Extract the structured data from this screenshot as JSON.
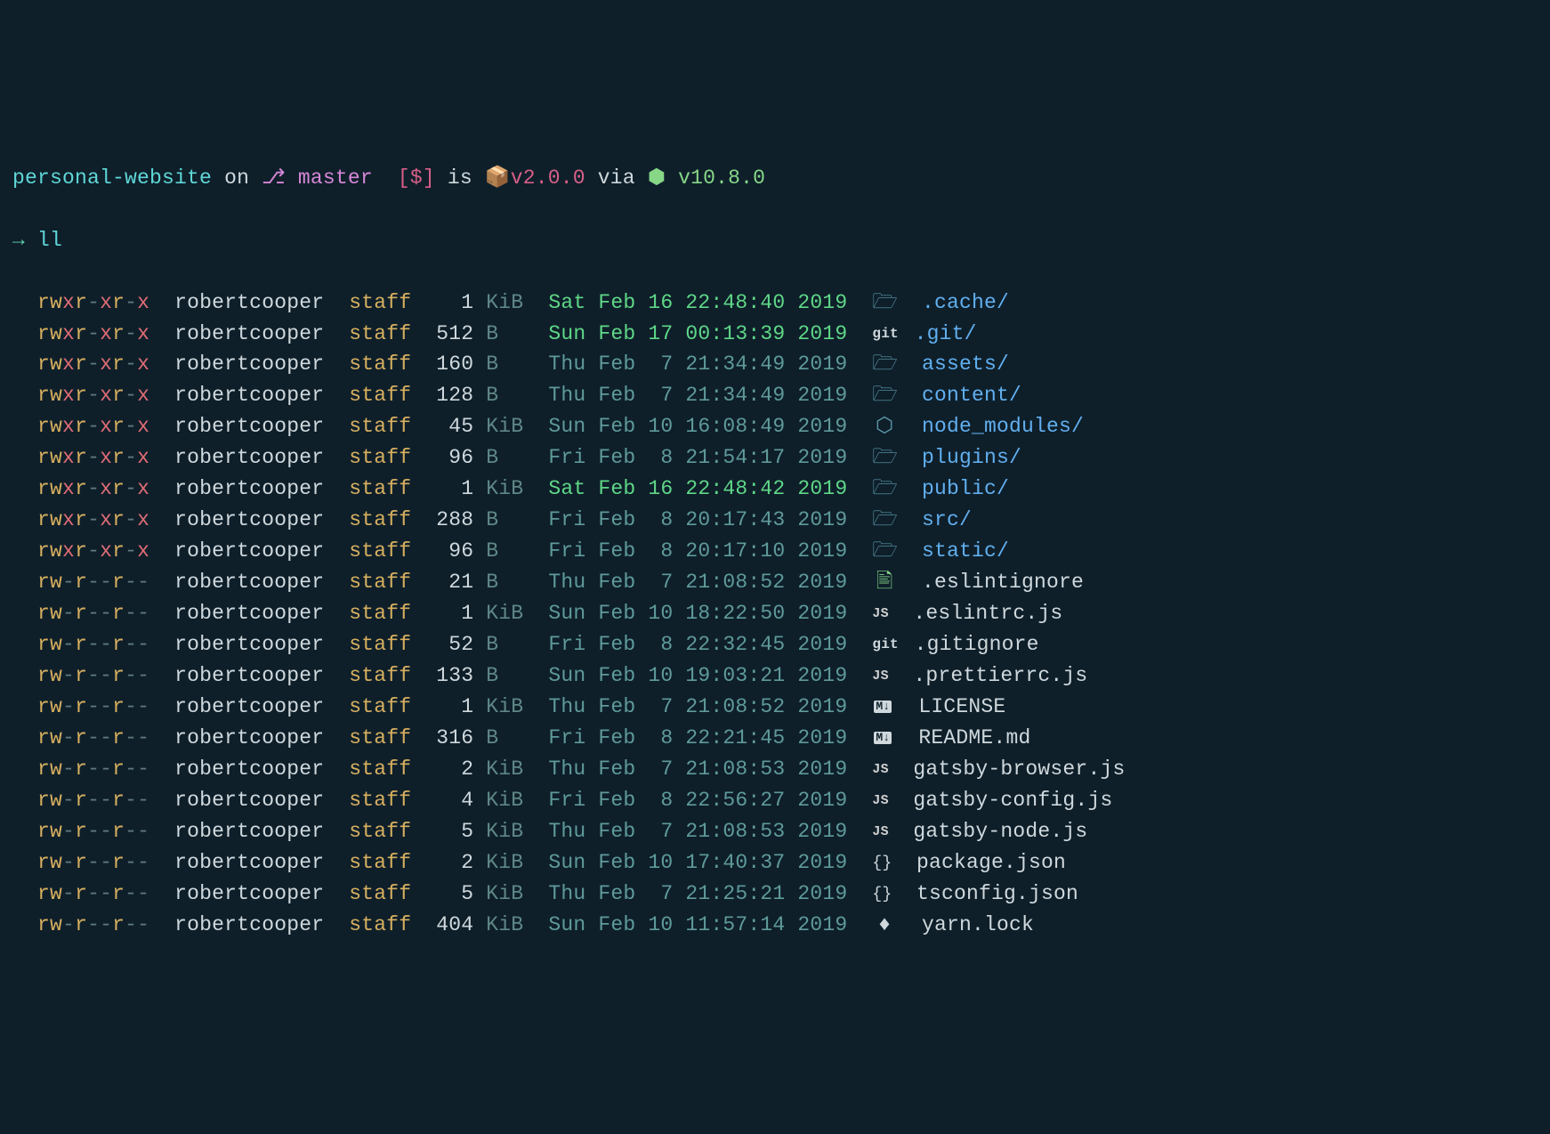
{
  "prompt": {
    "dir": "personal-website",
    "on": "on",
    "branch_icon": "⎇",
    "branch": "master",
    "status": "[$]",
    "is": "is",
    "pkg_icon": "📦",
    "version": "v2.0.0",
    "via": "via",
    "node_icon": "⬢",
    "node_version": "v10.8.0",
    "arrow": "→",
    "command": "ll"
  },
  "rows": [
    {
      "perm": "rwxr-xr-x",
      "owner": "robertcooper",
      "group": "staff",
      "size_n": "1",
      "size_u": "KiB",
      "date": "Sat Feb 16 22:48:40 2019",
      "bright": true,
      "icon": "folder",
      "name": ".cache/",
      "dir": true
    },
    {
      "perm": "rwxr-xr-x",
      "owner": "robertcooper",
      "group": "staff",
      "size_n": "512",
      "size_u": "B",
      "date": "Sun Feb 17 00:13:39 2019",
      "bright": true,
      "icon": "git",
      "name": ".git/",
      "dir": true
    },
    {
      "perm": "rwxr-xr-x",
      "owner": "robertcooper",
      "group": "staff",
      "size_n": "160",
      "size_u": "B",
      "date": "Thu Feb  7 21:34:49 2019",
      "bright": false,
      "icon": "folder",
      "name": "assets/",
      "dir": true
    },
    {
      "perm": "rwxr-xr-x",
      "owner": "robertcooper",
      "group": "staff",
      "size_n": "128",
      "size_u": "B",
      "date": "Thu Feb  7 21:34:49 2019",
      "bright": false,
      "icon": "folder",
      "name": "content/",
      "dir": true
    },
    {
      "perm": "rwxr-xr-x",
      "owner": "robertcooper",
      "group": "staff",
      "size_n": "45",
      "size_u": "KiB",
      "date": "Sun Feb 10 16:08:49 2019",
      "bright": false,
      "icon": "node",
      "name": "node_modules/",
      "dir": true
    },
    {
      "perm": "rwxr-xr-x",
      "owner": "robertcooper",
      "group": "staff",
      "size_n": "96",
      "size_u": "B",
      "date": "Fri Feb  8 21:54:17 2019",
      "bright": false,
      "icon": "folder",
      "name": "plugins/",
      "dir": true
    },
    {
      "perm": "rwxr-xr-x",
      "owner": "robertcooper",
      "group": "staff",
      "size_n": "1",
      "size_u": "KiB",
      "date": "Sat Feb 16 22:48:42 2019",
      "bright": true,
      "icon": "folder",
      "name": "public/",
      "dir": true
    },
    {
      "perm": "rwxr-xr-x",
      "owner": "robertcooper",
      "group": "staff",
      "size_n": "288",
      "size_u": "B",
      "date": "Fri Feb  8 20:17:43 2019",
      "bright": false,
      "icon": "folder",
      "name": "src/",
      "dir": true
    },
    {
      "perm": "rwxr-xr-x",
      "owner": "robertcooper",
      "group": "staff",
      "size_n": "96",
      "size_u": "B",
      "date": "Fri Feb  8 20:17:10 2019",
      "bright": false,
      "icon": "folder",
      "name": "static/",
      "dir": true
    },
    {
      "perm": "rw-r--r--",
      "owner": "robertcooper",
      "group": "staff",
      "size_n": "21",
      "size_u": "B",
      "date": "Thu Feb  7 21:08:52 2019",
      "bright": false,
      "icon": "file-green",
      "name": ".eslintignore",
      "dir": false
    },
    {
      "perm": "rw-r--r--",
      "owner": "robertcooper",
      "group": "staff",
      "size_n": "1",
      "size_u": "KiB",
      "date": "Sun Feb 10 18:22:50 2019",
      "bright": false,
      "icon": "js",
      "name": ".eslintrc.js",
      "dir": false
    },
    {
      "perm": "rw-r--r--",
      "owner": "robertcooper",
      "group": "staff",
      "size_n": "52",
      "size_u": "B",
      "date": "Fri Feb  8 22:32:45 2019",
      "bright": false,
      "icon": "git",
      "name": ".gitignore",
      "dir": false
    },
    {
      "perm": "rw-r--r--",
      "owner": "robertcooper",
      "group": "staff",
      "size_n": "133",
      "size_u": "B",
      "date": "Sun Feb 10 19:03:21 2019",
      "bright": false,
      "icon": "js",
      "name": ".prettierrc.js",
      "dir": false
    },
    {
      "perm": "rw-r--r--",
      "owner": "robertcooper",
      "group": "staff",
      "size_n": "1",
      "size_u": "KiB",
      "date": "Thu Feb  7 21:08:52 2019",
      "bright": false,
      "icon": "md",
      "name": "LICENSE",
      "dir": false
    },
    {
      "perm": "rw-r--r--",
      "owner": "robertcooper",
      "group": "staff",
      "size_n": "316",
      "size_u": "B",
      "date": "Fri Feb  8 22:21:45 2019",
      "bright": false,
      "icon": "md",
      "name": "README.md",
      "dir": false
    },
    {
      "perm": "rw-r--r--",
      "owner": "robertcooper",
      "group": "staff",
      "size_n": "2",
      "size_u": "KiB",
      "date": "Thu Feb  7 21:08:53 2019",
      "bright": false,
      "icon": "js",
      "name": "gatsby-browser.js",
      "dir": false
    },
    {
      "perm": "rw-r--r--",
      "owner": "robertcooper",
      "group": "staff",
      "size_n": "4",
      "size_u": "KiB",
      "date": "Fri Feb  8 22:56:27 2019",
      "bright": false,
      "icon": "js",
      "name": "gatsby-config.js",
      "dir": false
    },
    {
      "perm": "rw-r--r--",
      "owner": "robertcooper",
      "group": "staff",
      "size_n": "5",
      "size_u": "KiB",
      "date": "Thu Feb  7 21:08:53 2019",
      "bright": false,
      "icon": "js",
      "name": "gatsby-node.js",
      "dir": false
    },
    {
      "perm": "rw-r--r--",
      "owner": "robertcooper",
      "group": "staff",
      "size_n": "2",
      "size_u": "KiB",
      "date": "Sun Feb 10 17:40:37 2019",
      "bright": false,
      "icon": "json",
      "name": "package.json",
      "dir": false
    },
    {
      "perm": "rw-r--r--",
      "owner": "robertcooper",
      "group": "staff",
      "size_n": "5",
      "size_u": "KiB",
      "date": "Thu Feb  7 21:25:21 2019",
      "bright": false,
      "icon": "json",
      "name": "tsconfig.json",
      "dir": false
    },
    {
      "perm": "rw-r--r--",
      "owner": "robertcooper",
      "group": "staff",
      "size_n": "404",
      "size_u": "KiB",
      "date": "Sun Feb 10 11:57:14 2019",
      "bright": false,
      "icon": "lock",
      "name": "yarn.lock",
      "dir": false
    }
  ],
  "icons": {
    "folder": "🗁",
    "node": "⬡",
    "git": "git",
    "js": "JS",
    "md": "M↓",
    "json": "{}",
    "lock": "♦",
    "file-green": "🖹"
  }
}
